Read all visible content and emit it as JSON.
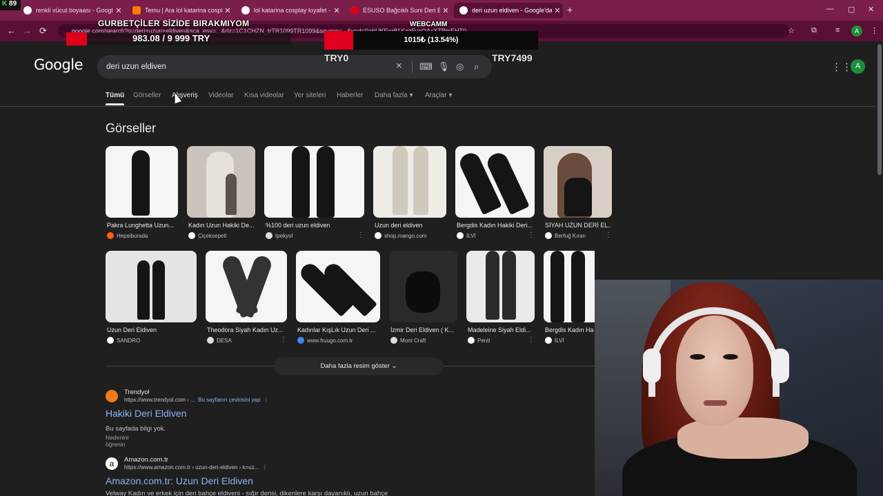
{
  "browser": {
    "tabs": [
      {
        "title": "renkli vücut boyaası - Google'da",
        "favicon_color": "#ffffff"
      },
      {
        "title": "Temu | Ara lol katarina cosplay",
        "favicon_color": "#ff7a00"
      },
      {
        "title": "lol katarina cosplay kıyafet - Go",
        "favicon_color": "#ffffff"
      },
      {
        "title": "ESUSO Bağcıklı Suni Deri Büstiy",
        "favicon_color": "#e0001b"
      },
      {
        "title": "deri uzun eldiven - Google'da A",
        "favicon_color": "#ffffff",
        "active": true
      }
    ],
    "new_tab": "+",
    "url": "google.com/search?q=deri+uzun+eldiven&sca_esv=...&rlz=1C1CHZN_trTR1099TR1099&source=...&ved=0ahUKEwj81Kzq5veQAxXTBtsEHT0...",
    "profile_initial": "A",
    "nav": {
      "back": "←",
      "forward": "→",
      "reload": "⟳"
    },
    "window_controls": {
      "minimize": "—",
      "maximize": "▢",
      "close": "✕"
    }
  },
  "stream_overlay": {
    "badge_k": "K",
    "badge_count": "89",
    "title": "GURBETÇİLER SİZİDE BIRAKMIYOM",
    "goal_text": "983.08 / 9 999 TRY",
    "webcam_label": "WEBCAMM",
    "bar_label": "1015₺ (13.54%)",
    "bar_percent": 13.54,
    "min_label": "TRY0",
    "max_label": "TRY7499"
  },
  "google": {
    "logo": "Google",
    "query": "deri uzun eldiven",
    "clear_icon": "×",
    "avatar_initial": "A",
    "tabs": [
      {
        "label": "Tümü",
        "active": true
      },
      {
        "label": "Görseller"
      },
      {
        "label": "Alışveriş"
      },
      {
        "label": "Videolar"
      },
      {
        "label": "Kısa videolar"
      },
      {
        "label": "Yer siteleri"
      },
      {
        "label": "Haberler"
      },
      {
        "label": "Daha fazla ▾"
      },
      {
        "label": "Araçlar ▾"
      }
    ],
    "images_title": "Görseller",
    "images_row1": [
      {
        "caption": "Pakra Lunghetta Uzun...",
        "source": "Hepsiburada",
        "icon_color": "#ff6000"
      },
      {
        "caption": "Kadın Uzun Hakiki De...",
        "source": "Çiçeksepeti",
        "icon_color": "#ffffff"
      },
      {
        "caption": "%100 deri uzun eldiven",
        "source": "Ipekyol",
        "icon_color": "#dddddd"
      },
      {
        "caption": "Uzun deri eldiven",
        "source": "shop.mango.com",
        "icon_color": "#ffffff"
      },
      {
        "caption": "Bergdis Kadın Hakiki Deri...",
        "source": "İLVİ",
        "icon_color": "#ffffff"
      },
      {
        "caption": "SİYAH UZUN DERİ EL...",
        "source": "Berfuğ Kıran",
        "icon_color": "#ffffff"
      }
    ],
    "images_row2": [
      {
        "caption": "Uzun Deri Eldiven",
        "source": "SANDRO",
        "icon_color": "#ffffff"
      },
      {
        "caption": "Theodora Siyah Kadın Uz...",
        "source": "DESA",
        "icon_color": "#dddddd"
      },
      {
        "caption": "Kadınlar KışLık Uzun Deri ...",
        "source": "www.fruugo.com.tr",
        "icon_color": "#4285f4"
      },
      {
        "caption": "İzmir Deri Eldiven ( K...",
        "source": "Mont Craft",
        "icon_color": "#dddddd"
      },
      {
        "caption": "Madeleine Siyah Eldi...",
        "source": "Penti",
        "icon_color": "#ffffff"
      },
      {
        "caption": "Bergdis Kadın Ha",
        "source": "İLVİ",
        "icon_color": "#ffffff"
      }
    ],
    "more_images": "Daha fazla resim göster",
    "results": [
      {
        "site": "Trendyol",
        "path": "https://www.trendyol.com › ...",
        "translate": "Bu sayfanın çevirisini yap",
        "title": "Hakiki Deri Eldiven",
        "snippet": "Bu sayfada bilgi yok.",
        "why": "Nedenini öğrenin",
        "favicon_color": "#f27a1a"
      },
      {
        "site": "Amazon.com.tr",
        "path": "https://www.amazon.com.tr › uzun-deri-eldiven › k=uz...",
        "title": "Amazon.com.tr: Uzun Deri Eldiven",
        "snippet": "Velway Kadın ve erkek için deri bahçe eldiveni - sığır derisi, dikenlere karşı dayanıklı, uzun bahçe",
        "favicon_color": "#ffffff"
      }
    ]
  }
}
